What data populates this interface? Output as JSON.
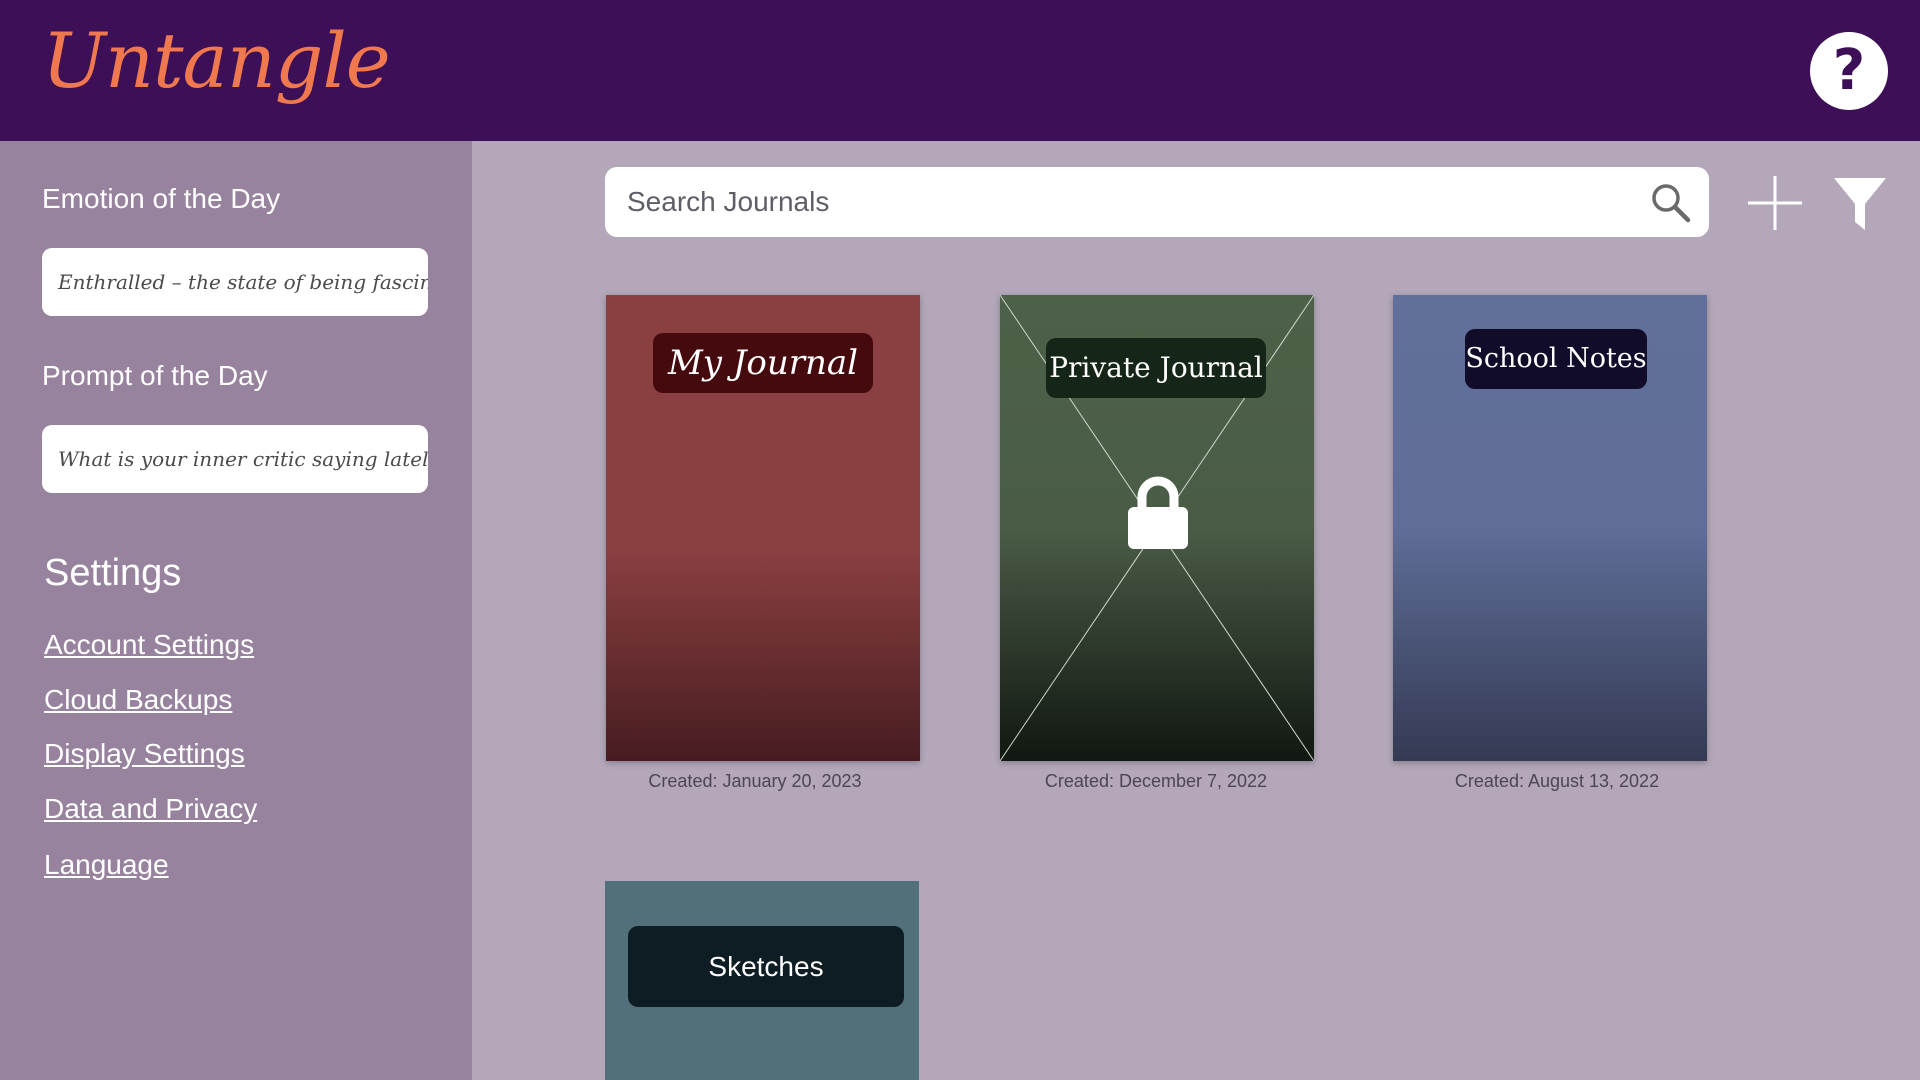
{
  "header": {
    "app_name": "Untangle",
    "help_label": "?"
  },
  "sidebar": {
    "emotion_heading": "Emotion of the Day",
    "emotion_text": "Enthralled – the state of being fascinated",
    "prompt_heading": "Prompt of the Day",
    "prompt_text": "What is your inner critic saying lately?",
    "settings_heading": "Settings",
    "settings_links": [
      "Account Settings",
      "Cloud Backups",
      "Display Settings",
      "Data and Privacy",
      "Language"
    ]
  },
  "search": {
    "placeholder": "Search Journals"
  },
  "toolbar": {
    "add_icon": "plus-icon",
    "filter_icon": "filter-icon"
  },
  "journals": [
    {
      "title": "My Journal",
      "created": "Created: January 20, 2023",
      "color": "#8a3f41",
      "locked": false
    },
    {
      "title": "Private Journal",
      "created": "Created: December 7, 2022",
      "color": "#4d6149",
      "locked": true
    },
    {
      "title": "School Notes",
      "created": "Created: August 13, 2022",
      "color": "#616f9b",
      "locked": false
    },
    {
      "title": "Sketches",
      "created": "",
      "color": "#527079",
      "locked": false
    }
  ],
  "colors": {
    "header_bg": "#3d0f57",
    "logo": "#f0784e",
    "sidebar_bg": "#98839e",
    "main_bg": "#b3a7b9"
  }
}
